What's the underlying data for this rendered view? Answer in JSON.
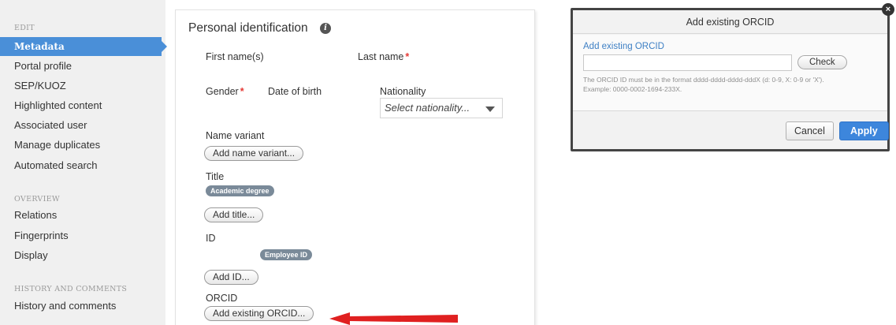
{
  "sidebar": {
    "sections": [
      {
        "heading": "EDIT",
        "items": [
          "Metadata",
          "Portal profile",
          "SEP/KUOZ",
          "Highlighted content",
          "Associated user",
          "Manage duplicates",
          "Automated search"
        ]
      },
      {
        "heading": "OVERVIEW",
        "items": [
          "Relations",
          "Fingerprints",
          "Display"
        ]
      },
      {
        "heading": "HISTORY AND COMMENTS",
        "items": [
          "History and comments"
        ]
      }
    ],
    "active_item": "Metadata"
  },
  "form": {
    "title": "Personal identification",
    "info_icon": "i",
    "first_name_label": "First name(s)",
    "last_name_label": "Last name",
    "required_mark": "*",
    "gender_label": "Gender",
    "date_of_birth_label": "Date of birth",
    "nationality_label": "Nationality",
    "nationality_placeholder": "Select nationality...",
    "name_variant_label": "Name variant",
    "add_name_variant_button": "Add name variant...",
    "title_label": "Title",
    "academic_degree_badge": "Academic degree",
    "add_title_button": "Add title...",
    "id_label": "ID",
    "employee_id_badge": "Employee ID",
    "add_id_button": "Add ID...",
    "orcid_label": "ORCID",
    "add_existing_orcid_button": "Add existing ORCID..."
  },
  "annotation": {
    "arrow_color": "#e02020"
  },
  "dialog": {
    "title": "Add existing ORCID",
    "close_icon": "×",
    "field_label": "Add existing ORCID",
    "input_value": "",
    "check_button": "Check",
    "help_line1": "The ORCID ID must be in the format dddd-dddd-dddd-dddX (d: 0-9, X: 0-9 or 'X').",
    "help_line2": "Example: 0000-0002-1694-233X.",
    "cancel_button": "Cancel",
    "apply_button": "Apply"
  },
  "colors": {
    "accent": "#4a8fd8",
    "required": "#e53935",
    "badge": "#7a8a99",
    "apply": "#3d86dc"
  }
}
